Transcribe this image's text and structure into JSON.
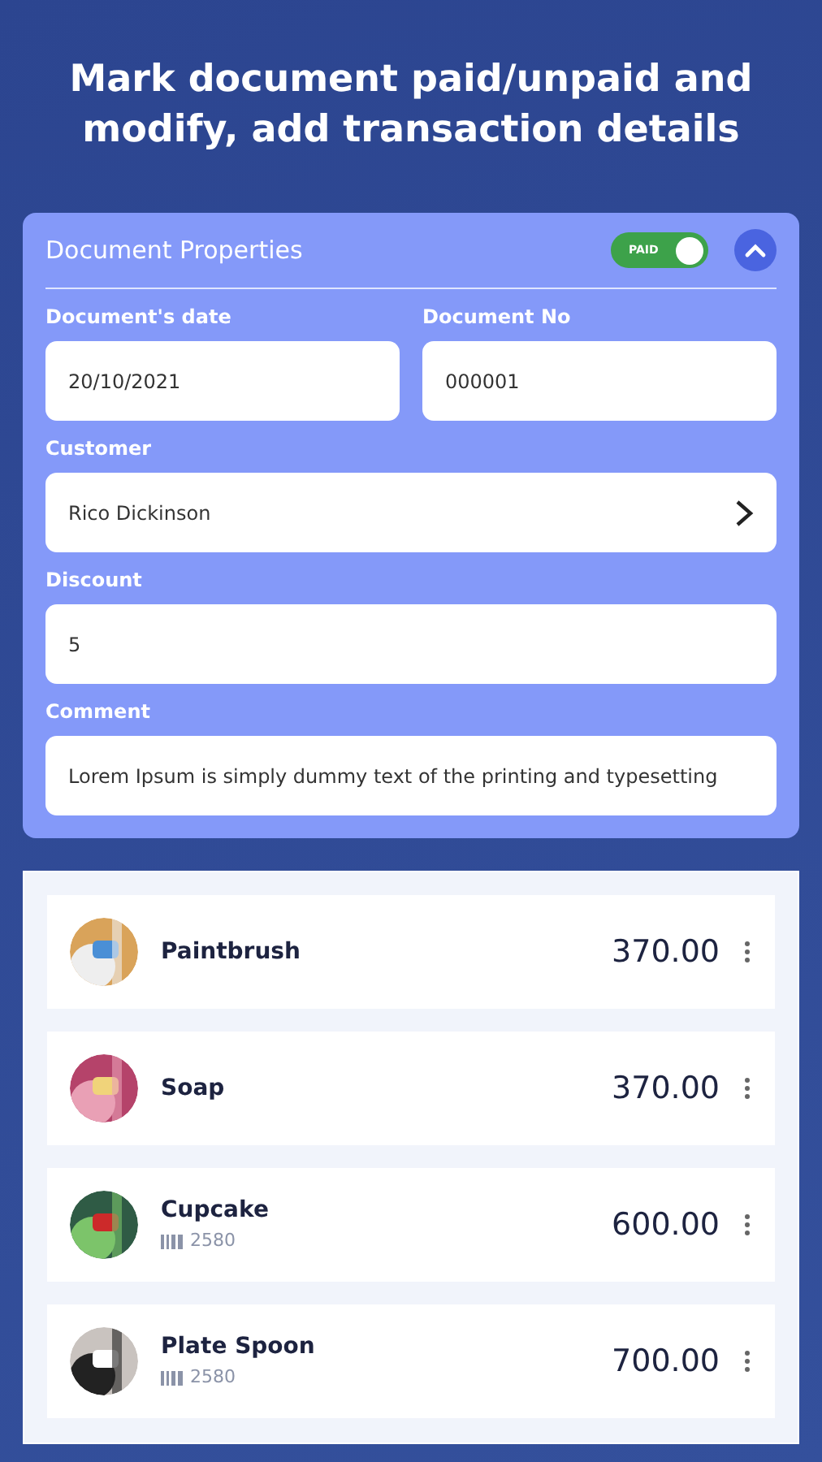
{
  "headline": "Mark document paid/unpaid and modify, add transaction details",
  "properties": {
    "title": "Document Properties",
    "paid_toggle": {
      "label": "PAID",
      "on": true
    },
    "expanded": true,
    "fields": [
      {
        "kind": "half",
        "label": "Document's date",
        "value": "20/10/2021"
      },
      {
        "kind": "half",
        "label": "Document No",
        "value": "000001"
      },
      {
        "kind": "select",
        "label": "Customer",
        "value": "Rico Dickinson"
      },
      {
        "kind": "full",
        "label": "Discount",
        "value": "5"
      },
      {
        "kind": "full",
        "label": "Comment",
        "value": "Lorem Ipsum is simply dummy text of the printing and typesetting"
      }
    ]
  },
  "items": [
    {
      "name": "Paintbrush",
      "amount": "370.00"
    },
    {
      "name": "Soap",
      "amount": "370.00"
    },
    {
      "name": "Cupcake",
      "code": "2580",
      "amount": "600.00"
    },
    {
      "name": "Plate Spoon",
      "code": "2580",
      "amount": "700.00"
    }
  ]
}
